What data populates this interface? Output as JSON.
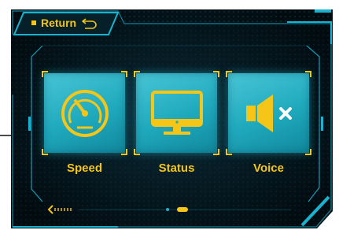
{
  "header": {
    "return_label": "Return",
    "return_icon": "return-arrow-icon"
  },
  "tiles": [
    {
      "label": "Speed",
      "icon": "speedometer-icon"
    },
    {
      "label": "Status",
      "icon": "monitor-icon"
    },
    {
      "label": "Voice",
      "icon": "speaker-muted-icon"
    }
  ],
  "pager": {
    "back_icon": "scroll-left-arrow-icon",
    "page_count": 2,
    "active_page": 2
  },
  "colors": {
    "background": "#03121a",
    "frame_cyan": "#19b3cf",
    "accent_yellow": "#f5c518",
    "tile_teal": "#22a9bc"
  }
}
